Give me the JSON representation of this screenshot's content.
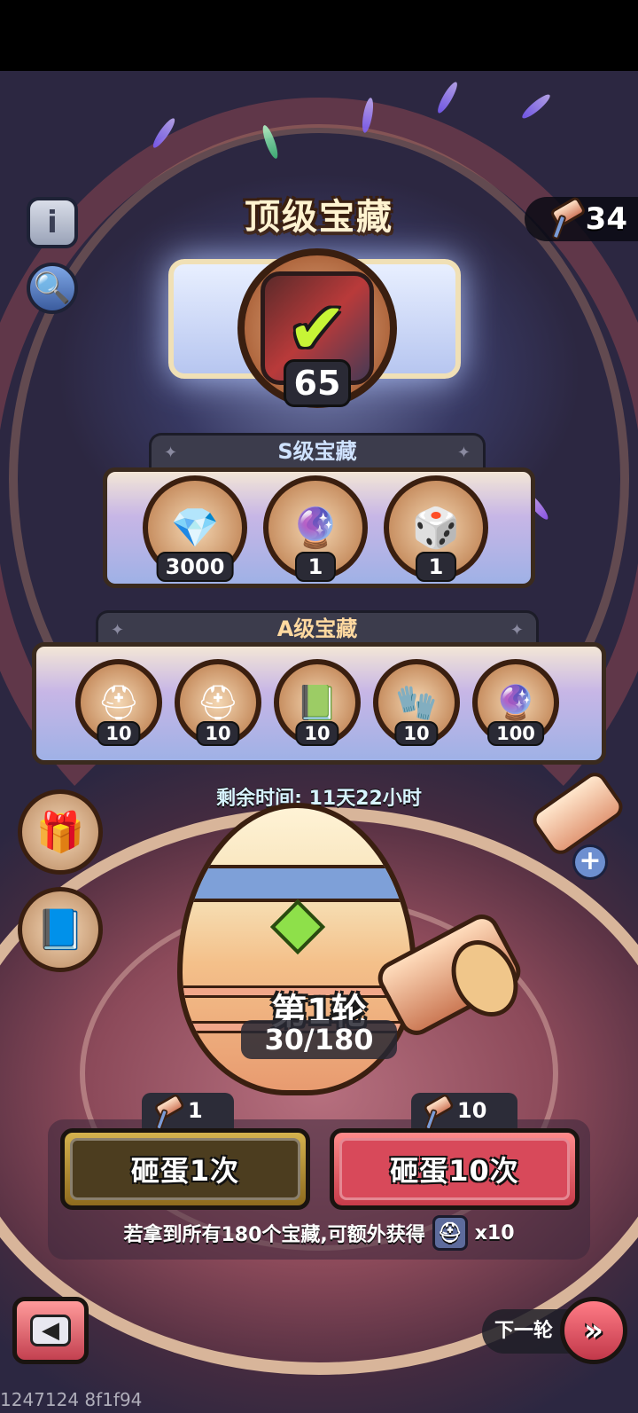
{
  "header": {
    "title": "顶级宝藏",
    "hammer_count": "34"
  },
  "top_prize": {
    "count": "65",
    "claimed_icon": "checkmark-icon"
  },
  "tiers": {
    "s": {
      "label": "S级宝藏",
      "rewards": [
        {
          "icon": "diamond-icon",
          "qty": "3000"
        },
        {
          "icon": "rune-crystal-icon",
          "qty": "1"
        },
        {
          "icon": "ssr-hero-selector-icon",
          "qty": "1"
        }
      ]
    },
    "a": {
      "label": "A级宝藏",
      "rewards": [
        {
          "icon": "steel-helmet-card-icon",
          "qty": "10"
        },
        {
          "icon": "bronze-helmet-card-icon",
          "qty": "10"
        },
        {
          "icon": "colorful-book-icon",
          "qty": "10"
        },
        {
          "icon": "silver-gauntlet-icon",
          "qty": "10"
        },
        {
          "icon": "purple-orb-icon",
          "qty": "100"
        }
      ]
    }
  },
  "timer": "剩余时间: 11天22小时",
  "round": {
    "label": "第1轮",
    "progress": "30/180"
  },
  "actions": {
    "smash_one_cost": "1",
    "smash_one_label": "砸蛋1次",
    "smash_ten_cost": "10",
    "smash_ten_label": "砸蛋10次"
  },
  "bonus": {
    "text": "若拿到所有180个宝藏,可额外获得",
    "qty": "x10"
  },
  "nav": {
    "next_round_label": "下一轮"
  },
  "build_id": "1247124 8f1f94",
  "colors": {
    "accent_red": "#c73c4a",
    "accent_gold": "#d4b24e",
    "check_green": "#c7f536"
  }
}
